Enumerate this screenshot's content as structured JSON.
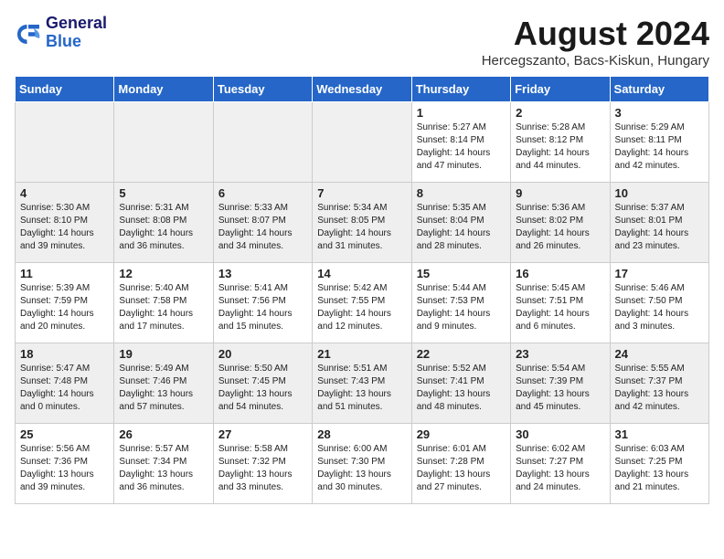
{
  "header": {
    "logo_line1": "General",
    "logo_line2": "Blue",
    "month_title": "August 2024",
    "subtitle": "Hercegszanto, Bacs-Kiskun, Hungary"
  },
  "weekdays": [
    "Sunday",
    "Monday",
    "Tuesday",
    "Wednesday",
    "Thursday",
    "Friday",
    "Saturday"
  ],
  "weeks": [
    [
      {
        "day": "",
        "info": ""
      },
      {
        "day": "",
        "info": ""
      },
      {
        "day": "",
        "info": ""
      },
      {
        "day": "",
        "info": ""
      },
      {
        "day": "1",
        "info": "Sunrise: 5:27 AM\nSunset: 8:14 PM\nDaylight: 14 hours\nand 47 minutes."
      },
      {
        "day": "2",
        "info": "Sunrise: 5:28 AM\nSunset: 8:12 PM\nDaylight: 14 hours\nand 44 minutes."
      },
      {
        "day": "3",
        "info": "Sunrise: 5:29 AM\nSunset: 8:11 PM\nDaylight: 14 hours\nand 42 minutes."
      }
    ],
    [
      {
        "day": "4",
        "info": "Sunrise: 5:30 AM\nSunset: 8:10 PM\nDaylight: 14 hours\nand 39 minutes."
      },
      {
        "day": "5",
        "info": "Sunrise: 5:31 AM\nSunset: 8:08 PM\nDaylight: 14 hours\nand 36 minutes."
      },
      {
        "day": "6",
        "info": "Sunrise: 5:33 AM\nSunset: 8:07 PM\nDaylight: 14 hours\nand 34 minutes."
      },
      {
        "day": "7",
        "info": "Sunrise: 5:34 AM\nSunset: 8:05 PM\nDaylight: 14 hours\nand 31 minutes."
      },
      {
        "day": "8",
        "info": "Sunrise: 5:35 AM\nSunset: 8:04 PM\nDaylight: 14 hours\nand 28 minutes."
      },
      {
        "day": "9",
        "info": "Sunrise: 5:36 AM\nSunset: 8:02 PM\nDaylight: 14 hours\nand 26 minutes."
      },
      {
        "day": "10",
        "info": "Sunrise: 5:37 AM\nSunset: 8:01 PM\nDaylight: 14 hours\nand 23 minutes."
      }
    ],
    [
      {
        "day": "11",
        "info": "Sunrise: 5:39 AM\nSunset: 7:59 PM\nDaylight: 14 hours\nand 20 minutes."
      },
      {
        "day": "12",
        "info": "Sunrise: 5:40 AM\nSunset: 7:58 PM\nDaylight: 14 hours\nand 17 minutes."
      },
      {
        "day": "13",
        "info": "Sunrise: 5:41 AM\nSunset: 7:56 PM\nDaylight: 14 hours\nand 15 minutes."
      },
      {
        "day": "14",
        "info": "Sunrise: 5:42 AM\nSunset: 7:55 PM\nDaylight: 14 hours\nand 12 minutes."
      },
      {
        "day": "15",
        "info": "Sunrise: 5:44 AM\nSunset: 7:53 PM\nDaylight: 14 hours\nand 9 minutes."
      },
      {
        "day": "16",
        "info": "Sunrise: 5:45 AM\nSunset: 7:51 PM\nDaylight: 14 hours\nand 6 minutes."
      },
      {
        "day": "17",
        "info": "Sunrise: 5:46 AM\nSunset: 7:50 PM\nDaylight: 14 hours\nand 3 minutes."
      }
    ],
    [
      {
        "day": "18",
        "info": "Sunrise: 5:47 AM\nSunset: 7:48 PM\nDaylight: 14 hours\nand 0 minutes."
      },
      {
        "day": "19",
        "info": "Sunrise: 5:49 AM\nSunset: 7:46 PM\nDaylight: 13 hours\nand 57 minutes."
      },
      {
        "day": "20",
        "info": "Sunrise: 5:50 AM\nSunset: 7:45 PM\nDaylight: 13 hours\nand 54 minutes."
      },
      {
        "day": "21",
        "info": "Sunrise: 5:51 AM\nSunset: 7:43 PM\nDaylight: 13 hours\nand 51 minutes."
      },
      {
        "day": "22",
        "info": "Sunrise: 5:52 AM\nSunset: 7:41 PM\nDaylight: 13 hours\nand 48 minutes."
      },
      {
        "day": "23",
        "info": "Sunrise: 5:54 AM\nSunset: 7:39 PM\nDaylight: 13 hours\nand 45 minutes."
      },
      {
        "day": "24",
        "info": "Sunrise: 5:55 AM\nSunset: 7:37 PM\nDaylight: 13 hours\nand 42 minutes."
      }
    ],
    [
      {
        "day": "25",
        "info": "Sunrise: 5:56 AM\nSunset: 7:36 PM\nDaylight: 13 hours\nand 39 minutes."
      },
      {
        "day": "26",
        "info": "Sunrise: 5:57 AM\nSunset: 7:34 PM\nDaylight: 13 hours\nand 36 minutes."
      },
      {
        "day": "27",
        "info": "Sunrise: 5:58 AM\nSunset: 7:32 PM\nDaylight: 13 hours\nand 33 minutes."
      },
      {
        "day": "28",
        "info": "Sunrise: 6:00 AM\nSunset: 7:30 PM\nDaylight: 13 hours\nand 30 minutes."
      },
      {
        "day": "29",
        "info": "Sunrise: 6:01 AM\nSunset: 7:28 PM\nDaylight: 13 hours\nand 27 minutes."
      },
      {
        "day": "30",
        "info": "Sunrise: 6:02 AM\nSunset: 7:27 PM\nDaylight: 13 hours\nand 24 minutes."
      },
      {
        "day": "31",
        "info": "Sunrise: 6:03 AM\nSunset: 7:25 PM\nDaylight: 13 hours\nand 21 minutes."
      }
    ]
  ]
}
